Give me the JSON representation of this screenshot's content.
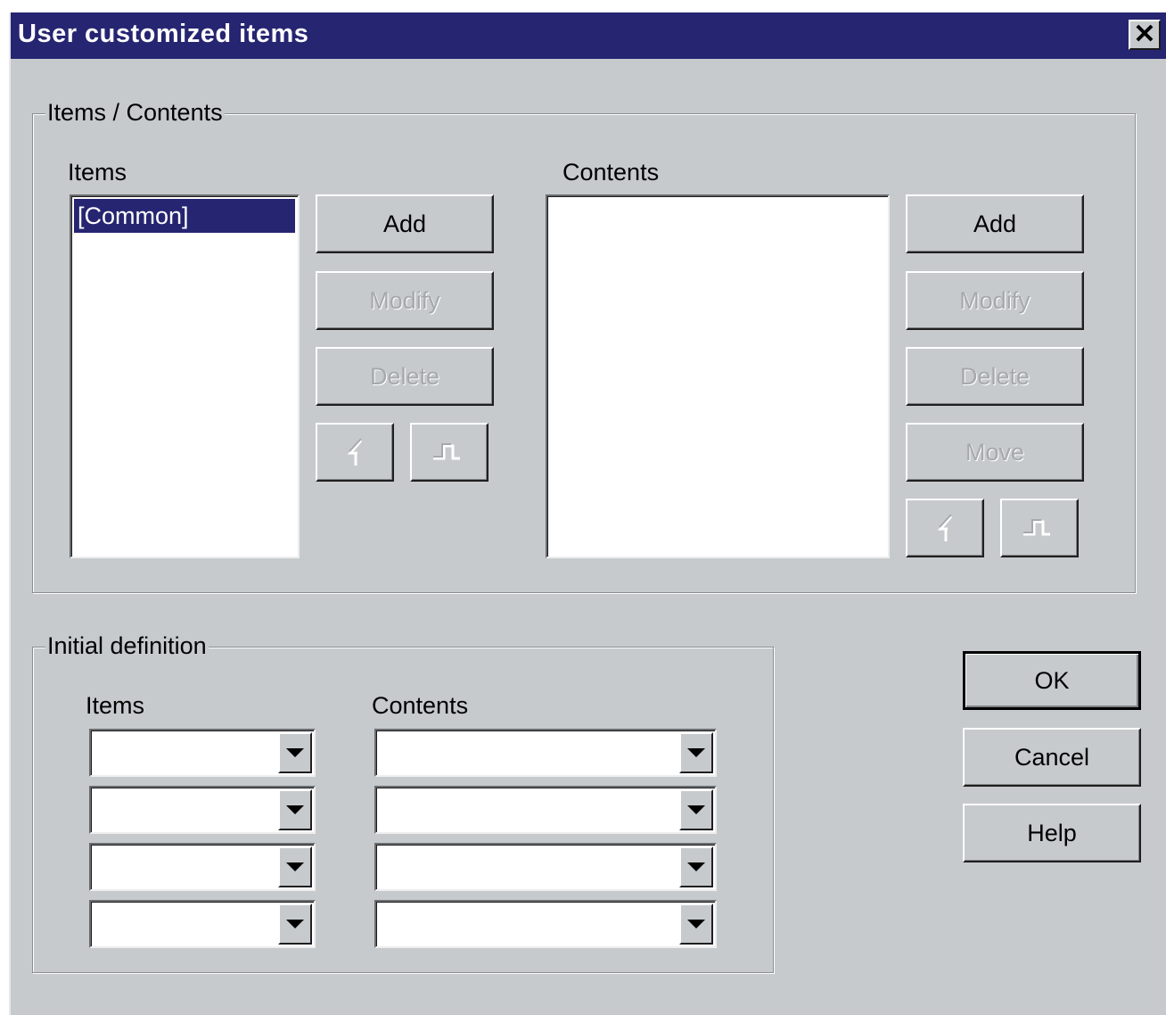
{
  "window": {
    "title": "User customized items",
    "close_icon": "close-icon"
  },
  "items_contents_group": {
    "label": "Items / Contents",
    "items_label": "Items",
    "items_list": [
      "[Common]"
    ],
    "items_add": "Add",
    "items_modify": "Modify",
    "items_delete": "Delete",
    "contents_label": "Contents",
    "contents_list": [],
    "contents_add": "Add",
    "contents_modify": "Modify",
    "contents_delete": "Delete",
    "contents_move": "Move"
  },
  "initial_definition_group": {
    "label": "Initial definition",
    "items_label": "Items",
    "contents_label": "Contents",
    "item_combos": [
      "",
      "",
      "",
      ""
    ],
    "content_combos": [
      "",
      "",
      "",
      ""
    ]
  },
  "buttons": {
    "ok": "OK",
    "cancel": "Cancel",
    "help": "Help"
  },
  "colors": {
    "title_bar": "#262571",
    "dialog_bg": "#c6cacd",
    "selection": "#262571"
  }
}
